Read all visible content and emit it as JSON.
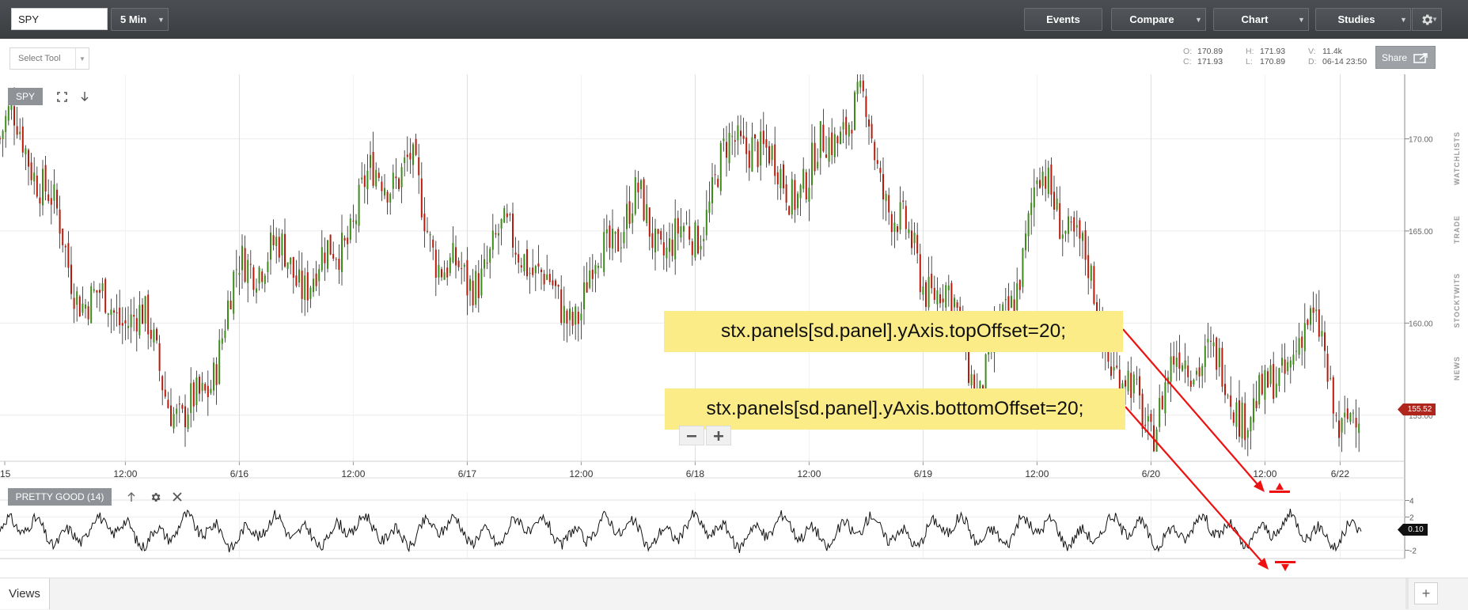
{
  "toolbar": {
    "symbol_value": "SPY",
    "interval_label": "5 Min",
    "events_label": "Events",
    "compare_label": "Compare",
    "chart_label": "Chart",
    "studies_label": "Studies"
  },
  "subbar": {
    "select_tool_label": "Select Tool",
    "share_label": "Share"
  },
  "hud": {
    "open_key": "O:",
    "open_value": "170.89",
    "close_key": "C:",
    "close_value": "171.93",
    "high_key": "H:",
    "high_value": "171.93",
    "low_key": "L:",
    "low_value": "170.89",
    "volume_key": "V:",
    "volume_value": "11.4k",
    "date_key": "D:",
    "date_value": "06-14 23:50"
  },
  "sidebar": {
    "tabs": [
      "WATCHLISTS",
      "TRADE",
      "STOCKTWITS",
      "NEWS"
    ]
  },
  "main_panel": {
    "symbol_label": "SPY",
    "current_price": "155.52"
  },
  "study_panel": {
    "label": "PRETTY GOOD (14)",
    "current_value": "0.10"
  },
  "annotations": {
    "top_offset_code": "stx.panels[sd.panel].yAxis.topOffset=20;",
    "bottom_offset_code": "stx.panels[sd.panel].yAxis.bottomOffset=20;"
  },
  "footer": {
    "views_label": "Views",
    "add_label": "+"
  },
  "colors": {
    "up": "#3d8c1a",
    "down": "#b51c0c",
    "price_tag": "#b0251c",
    "annotation_bg": "#fbec87",
    "arrow": "#ee1111"
  },
  "chart_data": {
    "type": "candlestick",
    "xlabel": "",
    "ylabel": "",
    "x_tick_labels": [
      "15",
      "12:00",
      "6/16",
      "12:00",
      "6/17",
      "12:00",
      "6/18",
      "12:00",
      "6/19",
      "12:00",
      "6/20",
      "12:00",
      "6/22"
    ],
    "y_tick_labels": [
      "170.00",
      "165.00",
      "160.00",
      "155.00"
    ],
    "ylim": [
      152.5,
      173.5
    ],
    "grid": true,
    "approx_close_path": [
      {
        "x": "6/15 00:00",
        "y": 170.0
      },
      {
        "x": "6/15 06:00",
        "y": 164.0
      },
      {
        "x": "6/15 12:00",
        "y": 160.0
      },
      {
        "x": "6/15 18:00",
        "y": 155.0
      },
      {
        "x": "6/16 00:00",
        "y": 162.0
      },
      {
        "x": "6/16 12:00",
        "y": 165.0
      },
      {
        "x": "6/16 18:00",
        "y": 169.0
      },
      {
        "x": "6/17 00:00",
        "y": 161.0
      },
      {
        "x": "6/17 06:00",
        "y": 165.0
      },
      {
        "x": "6/17 12:00",
        "y": 160.0
      },
      {
        "x": "6/17 18:00",
        "y": 167.0
      },
      {
        "x": "6/18 00:00",
        "y": 164.0
      },
      {
        "x": "6/18 06:00",
        "y": 171.0
      },
      {
        "x": "6/18 12:00",
        "y": 167.0
      },
      {
        "x": "6/18 18:00",
        "y": 172.0
      },
      {
        "x": "6/19 00:00",
        "y": 162.0
      },
      {
        "x": "6/19 06:00",
        "y": 157.0
      },
      {
        "x": "6/19 12:00",
        "y": 167.0
      },
      {
        "x": "6/19 18:00",
        "y": 162.0
      },
      {
        "x": "6/20 00:00",
        "y": 154.0
      },
      {
        "x": "6/20 06:00",
        "y": 159.0
      },
      {
        "x": "6/20 12:00",
        "y": 155.0
      },
      {
        "x": "6/20 18:00",
        "y": 160.0
      },
      {
        "x": "6/22 00:00",
        "y": 155.5
      }
    ],
    "study": {
      "name": "PRETTY GOOD (14)",
      "y_tick_labels": [
        "4",
        "2",
        "-2"
      ],
      "ylim": [
        -3,
        5
      ],
      "current": 0.1
    }
  }
}
